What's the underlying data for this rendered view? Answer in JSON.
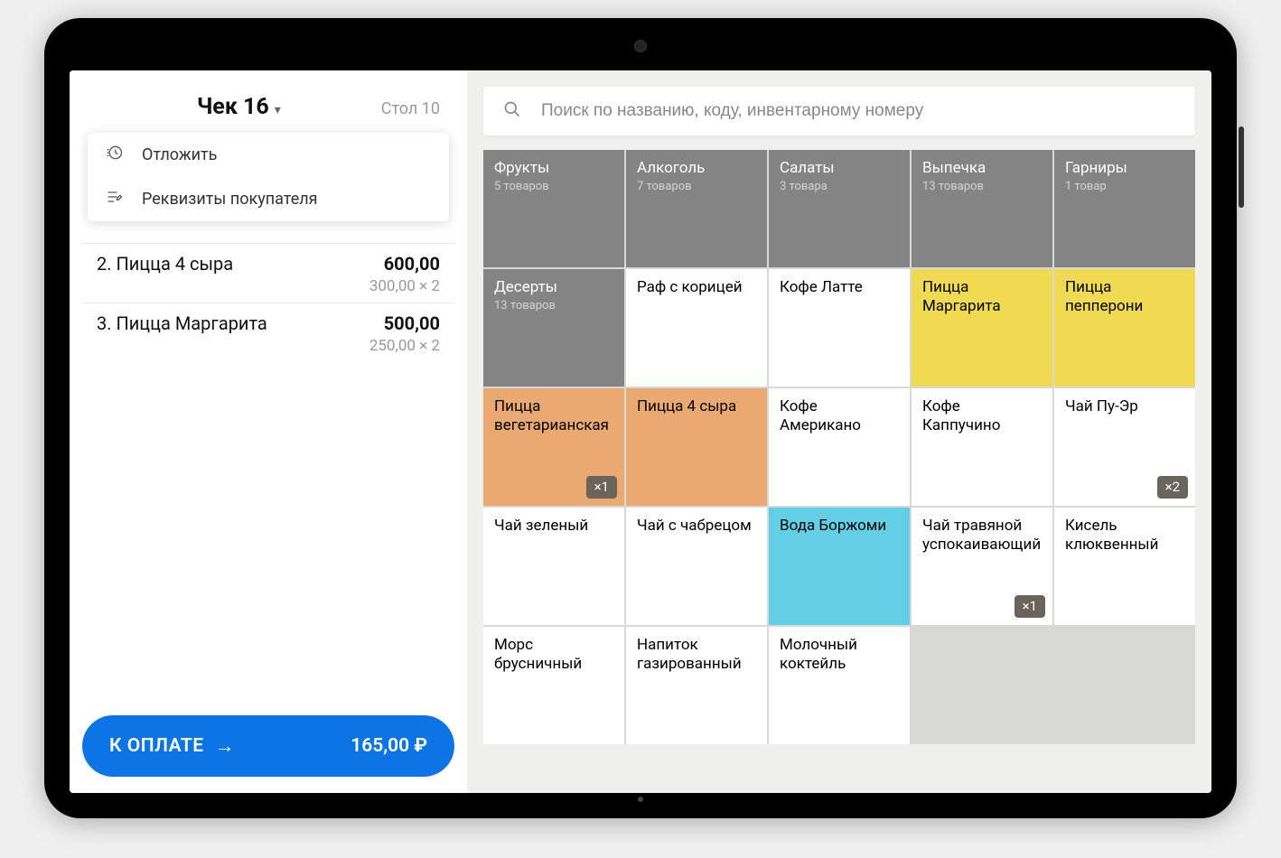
{
  "check": {
    "title": "Чек 16",
    "table": "Стол 10"
  },
  "menu": {
    "postpone": "Отложить",
    "customer_details": "Реквизиты покупателя"
  },
  "items": [
    {
      "idx": "2.",
      "name": "Пицца 4 сыра",
      "total": "600,00",
      "sub": "300,00 × 2"
    },
    {
      "idx": "3.",
      "name": "Пицца Маргарита",
      "total": "500,00",
      "sub": "250,00 × 2"
    }
  ],
  "pay": {
    "label": "К ОПЛАТЕ",
    "amount": "165,00 ₽"
  },
  "search": {
    "placeholder": "Поиск по названию, коду, инвентарному номеру"
  },
  "tiles": [
    {
      "type": "cat",
      "name": "Фрукты",
      "count": "5 товаров"
    },
    {
      "type": "cat",
      "name": "Алкоголь",
      "count": "7 товаров"
    },
    {
      "type": "cat",
      "name": "Салаты",
      "count": "3 товара"
    },
    {
      "type": "cat",
      "name": "Выпечка",
      "count": "13 товаров"
    },
    {
      "type": "cat",
      "name": "Гарниры",
      "count": "1 товар"
    },
    {
      "type": "cat",
      "name": "Десерты",
      "count": "13 товаров"
    },
    {
      "type": "prod",
      "name": "Раф с корицей"
    },
    {
      "type": "prod",
      "name": "Кофе Латте"
    },
    {
      "type": "prod",
      "name": "Пицца Маргарита",
      "color": "yellow"
    },
    {
      "type": "prod",
      "name": "Пицца пепперони",
      "color": "yellow"
    },
    {
      "type": "prod",
      "name": "Пицца вегетарианская",
      "color": "orange",
      "badge": "×1"
    },
    {
      "type": "prod",
      "name": "Пицца 4 сыра",
      "color": "orange"
    },
    {
      "type": "prod",
      "name": "Кофе Американо"
    },
    {
      "type": "prod",
      "name": "Кофе Каппучино"
    },
    {
      "type": "prod",
      "name": "Чай Пу-Эр",
      "badge": "×2"
    },
    {
      "type": "prod",
      "name": "Чай зеленый"
    },
    {
      "type": "prod",
      "name": "Чай с чабрецом"
    },
    {
      "type": "prod",
      "name": "Вода Боржоми",
      "color": "cyan"
    },
    {
      "type": "prod",
      "name": "Чай травяной успокаивающий",
      "badge": "×1"
    },
    {
      "type": "prod",
      "name": "Кисель клюквенный"
    },
    {
      "type": "prod",
      "name": "Морс брусничный"
    },
    {
      "type": "prod",
      "name": "Напиток газированный"
    },
    {
      "type": "prod",
      "name": "Молочный коктейль"
    }
  ]
}
